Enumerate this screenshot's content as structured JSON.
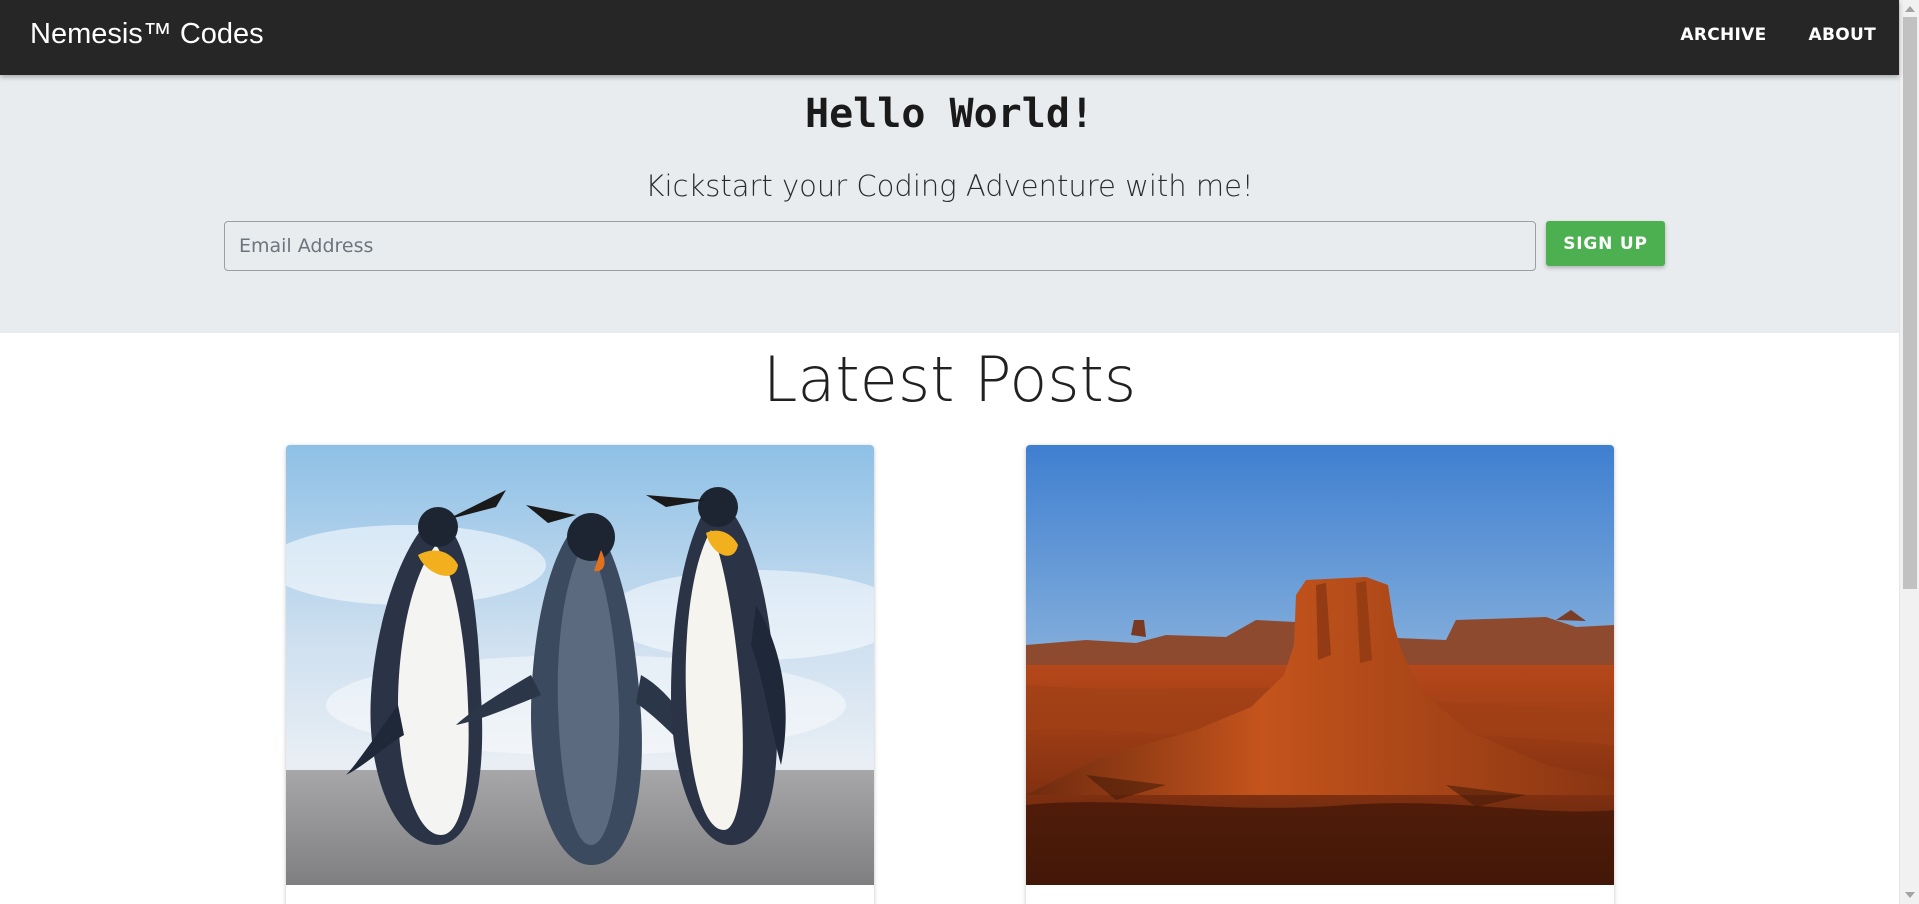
{
  "navbar": {
    "brand": "Nemesis™ Codes",
    "links": [
      {
        "label": "ARCHIVE"
      },
      {
        "label": "ABOUT"
      }
    ]
  },
  "hero": {
    "title": "Hello World!",
    "subtitle": "Kickstart your Coding Adventure with me!",
    "email_placeholder": "Email Address",
    "email_value": "",
    "signup_label": "SIGN UP"
  },
  "posts": {
    "section_title": "Latest Posts",
    "items": [
      {
        "image": "penguins-photo"
      },
      {
        "image": "desert-mesa-photo"
      }
    ]
  },
  "colors": {
    "navbar_bg": "#262626",
    "hero_bg": "#e9ecef",
    "signup_button": "#4caf50"
  }
}
